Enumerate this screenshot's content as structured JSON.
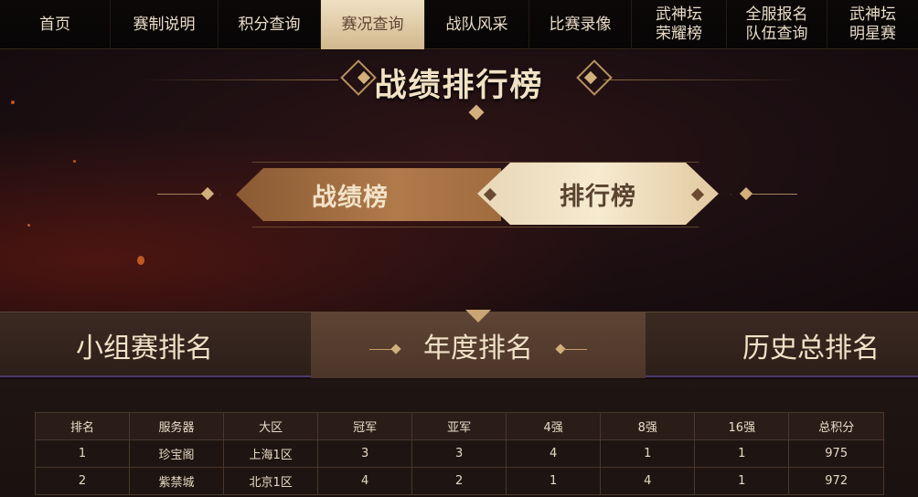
{
  "nav": {
    "items": [
      {
        "label": "首页",
        "active": false
      },
      {
        "label": "赛制说明",
        "active": false
      },
      {
        "label": "积分查询",
        "active": false
      },
      {
        "label": "赛况查询",
        "active": true
      },
      {
        "label": "战队风采",
        "active": false
      },
      {
        "label": "比赛录像",
        "active": false
      },
      {
        "label_line1": "武神坛",
        "label_line2": "荣耀榜",
        "active": false
      },
      {
        "label_line1": "全服报名",
        "label_line2": "队伍查询",
        "active": false
      },
      {
        "label_line1": "武神坛",
        "label_line2": "明星赛",
        "active": false
      }
    ]
  },
  "hero": {
    "title": "战绩排行榜",
    "toggle": {
      "left_label": "战绩榜",
      "right_label": "排行榜",
      "active": "排行榜"
    }
  },
  "subtabs": {
    "items": [
      {
        "label": "小组赛排名",
        "active": false
      },
      {
        "label": "年度排名",
        "active": true
      },
      {
        "label": "历史总排名",
        "active": false
      }
    ]
  },
  "table": {
    "headers": [
      "排名",
      "服务器",
      "大区",
      "冠军",
      "亚军",
      "4强",
      "8强",
      "16强",
      "总积分"
    ],
    "rows": [
      [
        "1",
        "珍宝阁",
        "上海1区",
        "3",
        "3",
        "4",
        "1",
        "1",
        "975"
      ],
      [
        "2",
        "紫禁城",
        "北京1区",
        "4",
        "2",
        "1",
        "4",
        "1",
        "972"
      ]
    ]
  },
  "colors": {
    "active_tab_bg": "#e6d3b0",
    "accent_gold": "#c9a574",
    "text_light": "#f1e2c8"
  }
}
